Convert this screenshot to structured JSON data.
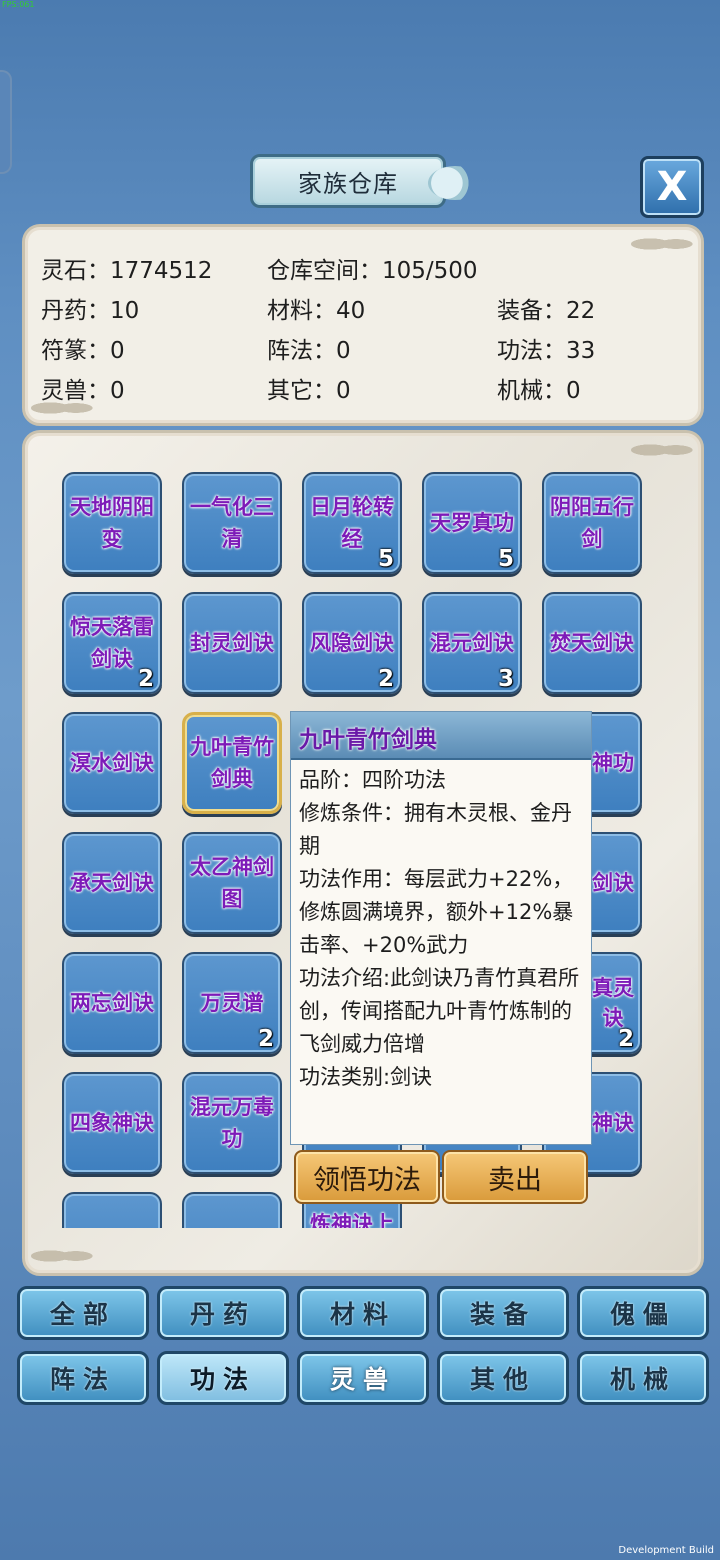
{
  "debug": {
    "fps": "FPS:061",
    "build": "Development Build"
  },
  "title": "家族仓库",
  "close_label": "X",
  "stats": {
    "spirit_stone": "灵石：1774512",
    "storage": "仓库空间：105/500",
    "pills": "丹药：10",
    "materials": "材料：40",
    "equipment": "装备：22",
    "talismans": "符篆：0",
    "formations": "阵法：0",
    "techniques": "功法：33",
    "beasts": "灵兽：0",
    "others": "其它：0",
    "machines": "机械：0"
  },
  "items": [
    {
      "name": "天地阴阳变",
      "count": ""
    },
    {
      "name": "一气化三清",
      "count": ""
    },
    {
      "name": "日月轮转经",
      "count": "5"
    },
    {
      "name": "天罗真功",
      "count": "5"
    },
    {
      "name": "阴阳五行剑",
      "count": ""
    },
    {
      "name": "惊天落雷剑诀",
      "count": "2"
    },
    {
      "name": "封灵剑诀",
      "count": ""
    },
    {
      "name": "风隐剑诀",
      "count": "2"
    },
    {
      "name": "混元剑诀",
      "count": "3"
    },
    {
      "name": "焚天剑诀",
      "count": ""
    },
    {
      "name": "溟水剑诀",
      "count": ""
    },
    {
      "name": "九叶青竹剑典",
      "count": ""
    },
    {
      "name": "神功",
      "count": ""
    },
    {
      "name": "承天剑诀",
      "count": ""
    },
    {
      "name": "太乙神剑图",
      "count": ""
    },
    {
      "name": "剑诀",
      "count": ""
    },
    {
      "name": "两忘剑诀",
      "count": ""
    },
    {
      "name": "万灵谱",
      "count": "2"
    },
    {
      "name": "真灵诀",
      "count": "2"
    },
    {
      "name": "四象神诀",
      "count": ""
    },
    {
      "name": "混元万毒功",
      "count": ""
    },
    {
      "name": "神诀",
      "count": ""
    },
    {
      "name": "炼神诀上",
      "count": ""
    }
  ],
  "tooltip": {
    "title": "九叶青竹剑典",
    "lines": [
      "品阶：四阶功法",
      "修炼条件：拥有木灵根、金丹期",
      "功法作用：每层武力+22%，修炼圆满境界，额外+12%暴击率、+20%武力",
      "功法介绍:此剑诀乃青竹真君所创，传闻搭配九叶青竹炼制的飞剑威力倍增",
      "功法类别:剑诀"
    ],
    "learn_label": "领悟功法",
    "sell_label": "卖出"
  },
  "tabs_row1": [
    "全部",
    "丹药",
    "材料",
    "装备",
    "傀儡"
  ],
  "tabs_row2": [
    "阵法",
    "功法",
    "灵兽",
    "其他",
    "机械"
  ],
  "active_tab": "功法"
}
